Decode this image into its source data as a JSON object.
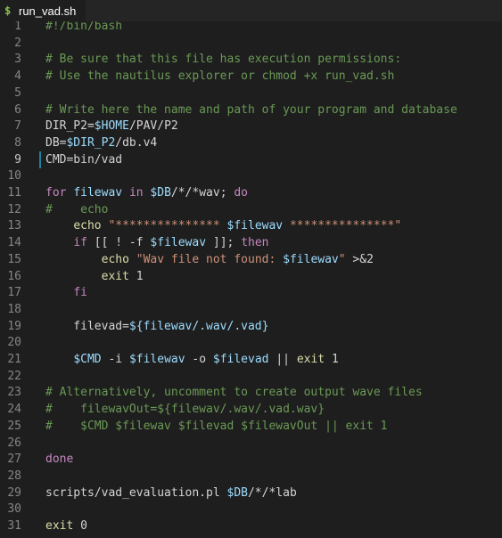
{
  "tab": {
    "icon": "$",
    "label": "run_vad.sh"
  },
  "editor": {
    "active_line": 9,
    "lines": [
      {
        "n": "1",
        "tokens": [
          {
            "t": "#!/bin/bash",
            "c": "t-comment"
          }
        ]
      },
      {
        "n": "2",
        "tokens": []
      },
      {
        "n": "3",
        "tokens": [
          {
            "t": "# Be sure that this file has execution permissions:",
            "c": "t-comment"
          }
        ]
      },
      {
        "n": "4",
        "tokens": [
          {
            "t": "# Use the nautilus explorer or chmod +x run_vad.sh",
            "c": "t-comment"
          }
        ]
      },
      {
        "n": "5",
        "tokens": []
      },
      {
        "n": "6",
        "tokens": [
          {
            "t": "# Write here the name and path of your program and database",
            "c": "t-comment"
          }
        ]
      },
      {
        "n": "7",
        "tokens": [
          {
            "t": "DIR_P2=",
            "c": "t-plain"
          },
          {
            "t": "$HOME",
            "c": "t-var"
          },
          {
            "t": "/PAV/P2",
            "c": "t-plain"
          }
        ]
      },
      {
        "n": "8",
        "tokens": [
          {
            "t": "DB=",
            "c": "t-plain"
          },
          {
            "t": "$DIR_P2",
            "c": "t-var"
          },
          {
            "t": "/db.v4",
            "c": "t-plain"
          }
        ]
      },
      {
        "n": "9",
        "tokens": [
          {
            "t": "CMD=bin/vad",
            "c": "t-plain"
          }
        ]
      },
      {
        "n": "10",
        "tokens": []
      },
      {
        "n": "11",
        "tokens": [
          {
            "t": "for",
            "c": "t-ctrl"
          },
          {
            "t": " ",
            "c": "t-plain"
          },
          {
            "t": "filewav",
            "c": "t-var"
          },
          {
            "t": " ",
            "c": "t-plain"
          },
          {
            "t": "in",
            "c": "t-ctrl"
          },
          {
            "t": " ",
            "c": "t-plain"
          },
          {
            "t": "$DB",
            "c": "t-var"
          },
          {
            "t": "/*/*wav; ",
            "c": "t-plain"
          },
          {
            "t": "do",
            "c": "t-ctrl"
          }
        ]
      },
      {
        "n": "12",
        "tokens": [
          {
            "t": "#    echo",
            "c": "t-comment"
          }
        ]
      },
      {
        "n": "13",
        "tokens": [
          {
            "t": "    ",
            "c": "t-plain"
          },
          {
            "t": "echo",
            "c": "t-fn"
          },
          {
            "t": " ",
            "c": "t-plain"
          },
          {
            "t": "\"*************** ",
            "c": "t-str"
          },
          {
            "t": "$filewav",
            "c": "t-var"
          },
          {
            "t": " ***************\"",
            "c": "t-str"
          }
        ]
      },
      {
        "n": "14",
        "tokens": [
          {
            "t": "    ",
            "c": "t-plain"
          },
          {
            "t": "if",
            "c": "t-ctrl"
          },
          {
            "t": " [[ ! -f ",
            "c": "t-plain"
          },
          {
            "t": "$filewav",
            "c": "t-var"
          },
          {
            "t": " ]]; ",
            "c": "t-plain"
          },
          {
            "t": "then",
            "c": "t-ctrl"
          }
        ]
      },
      {
        "n": "15",
        "tokens": [
          {
            "t": "        ",
            "c": "t-plain"
          },
          {
            "t": "echo",
            "c": "t-fn"
          },
          {
            "t": " ",
            "c": "t-plain"
          },
          {
            "t": "\"Wav file not found: ",
            "c": "t-str"
          },
          {
            "t": "$filewav",
            "c": "t-var"
          },
          {
            "t": "\"",
            "c": "t-str"
          },
          {
            "t": " >&2",
            "c": "t-plain"
          }
        ]
      },
      {
        "n": "16",
        "tokens": [
          {
            "t": "        ",
            "c": "t-plain"
          },
          {
            "t": "exit",
            "c": "t-fn"
          },
          {
            "t": " 1",
            "c": "t-plain"
          }
        ]
      },
      {
        "n": "17",
        "tokens": [
          {
            "t": "    ",
            "c": "t-plain"
          },
          {
            "t": "fi",
            "c": "t-ctrl"
          }
        ]
      },
      {
        "n": "18",
        "tokens": []
      },
      {
        "n": "19",
        "tokens": [
          {
            "t": "    filevad=",
            "c": "t-plain"
          },
          {
            "t": "${filewav/.wav/.vad}",
            "c": "t-var"
          }
        ]
      },
      {
        "n": "20",
        "tokens": []
      },
      {
        "n": "21",
        "tokens": [
          {
            "t": "    ",
            "c": "t-plain"
          },
          {
            "t": "$CMD",
            "c": "t-var"
          },
          {
            "t": " -i ",
            "c": "t-plain"
          },
          {
            "t": "$filewav",
            "c": "t-var"
          },
          {
            "t": " -o ",
            "c": "t-plain"
          },
          {
            "t": "$filevad",
            "c": "t-var"
          },
          {
            "t": " || ",
            "c": "t-plain"
          },
          {
            "t": "exit",
            "c": "t-fn"
          },
          {
            "t": " 1",
            "c": "t-plain"
          }
        ]
      },
      {
        "n": "22",
        "tokens": []
      },
      {
        "n": "23",
        "tokens": [
          {
            "t": "# Alternatively, uncomment to create output wave files",
            "c": "t-comment"
          }
        ]
      },
      {
        "n": "24",
        "tokens": [
          {
            "t": "#    filewavOut=${filewav/.wav/.vad.wav}",
            "c": "t-comment"
          }
        ]
      },
      {
        "n": "25",
        "tokens": [
          {
            "t": "#    $CMD $filewav $filevad $filewavOut || exit 1",
            "c": "t-comment"
          }
        ]
      },
      {
        "n": "26",
        "tokens": []
      },
      {
        "n": "27",
        "tokens": [
          {
            "t": "done",
            "c": "t-ctrl"
          }
        ]
      },
      {
        "n": "28",
        "tokens": []
      },
      {
        "n": "29",
        "tokens": [
          {
            "t": "scripts/vad_evaluation.pl ",
            "c": "t-plain"
          },
          {
            "t": "$DB",
            "c": "t-var"
          },
          {
            "t": "/*/*lab",
            "c": "t-plain"
          }
        ]
      },
      {
        "n": "30",
        "tokens": []
      },
      {
        "n": "31",
        "tokens": [
          {
            "t": "exit",
            "c": "t-fn"
          },
          {
            "t": " 0",
            "c": "t-plain"
          }
        ]
      }
    ]
  }
}
